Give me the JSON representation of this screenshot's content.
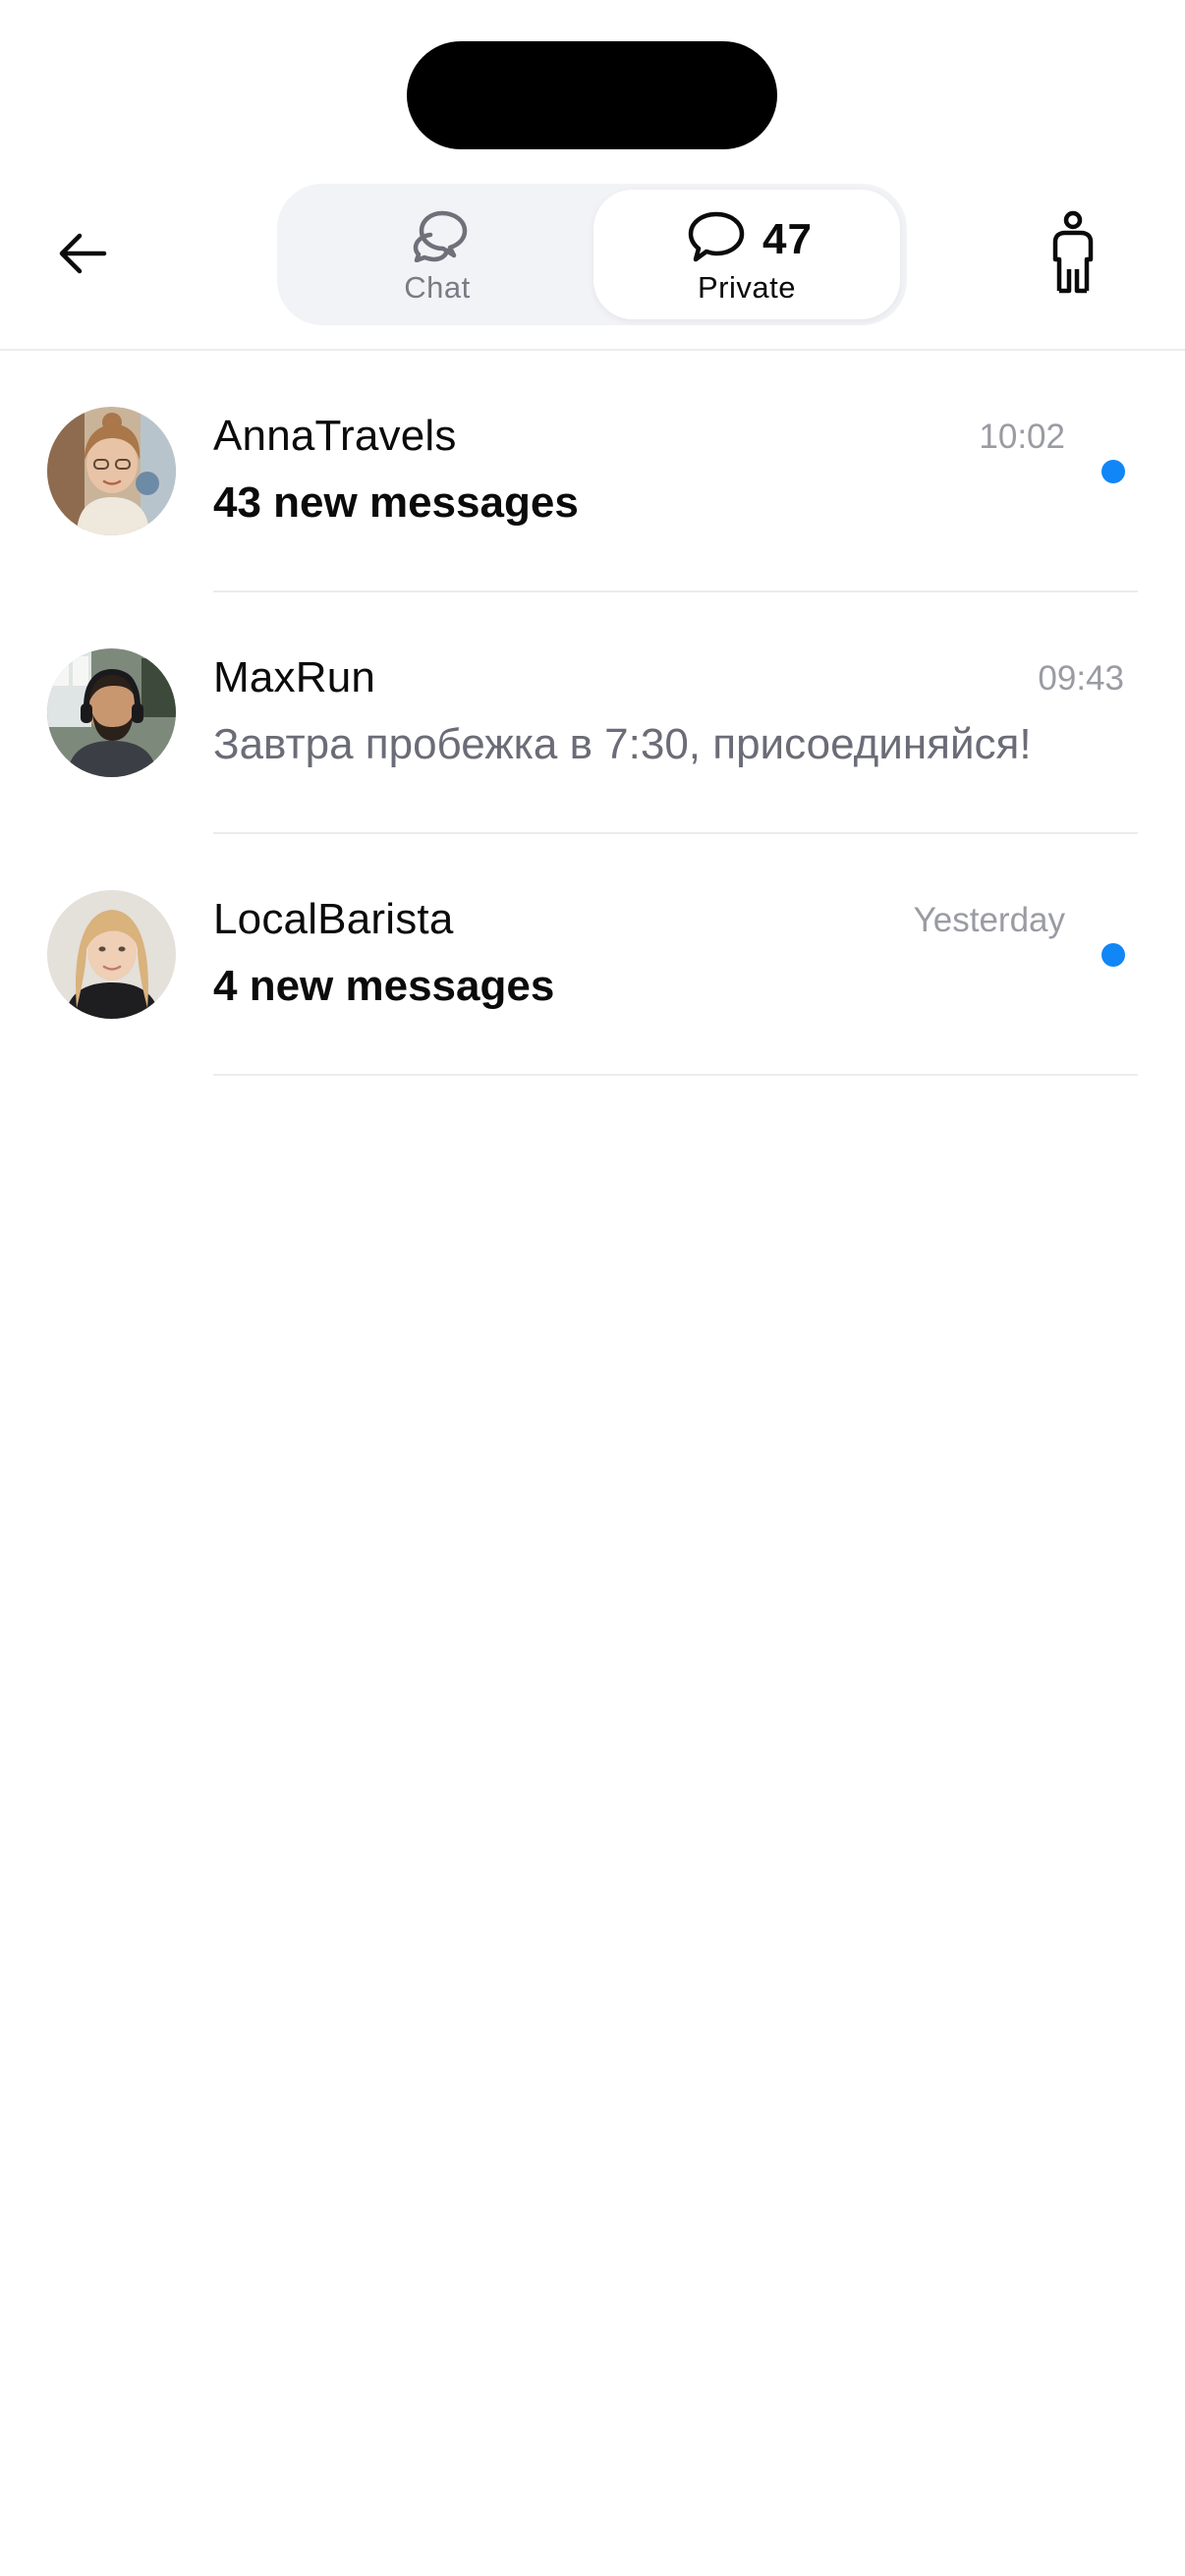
{
  "header": {
    "back_icon": "arrow-left-icon",
    "profile_icon": "person-icon",
    "tabs": [
      {
        "label": "Chat",
        "icon": "chat-bubbles-icon",
        "selected": false
      },
      {
        "label": "Private",
        "icon": "speech-bubble-icon",
        "count": "47",
        "selected": true
      }
    ]
  },
  "conversations": [
    {
      "name": "AnnaTravels",
      "time": "10:02",
      "preview": "43 new messages",
      "unread": true
    },
    {
      "name": "MaxRun",
      "time": "09:43",
      "preview": "Завтра пробежка в 7:30, присоединяйся!",
      "unread": false
    },
    {
      "name": "LocalBarista",
      "time": "Yesterday",
      "preview": "4 new messages",
      "unread": true
    }
  ],
  "colors": {
    "unread_dot": "#1186f7",
    "muted_text": "#9a9ba3",
    "segment_bg": "#f2f3f6"
  }
}
